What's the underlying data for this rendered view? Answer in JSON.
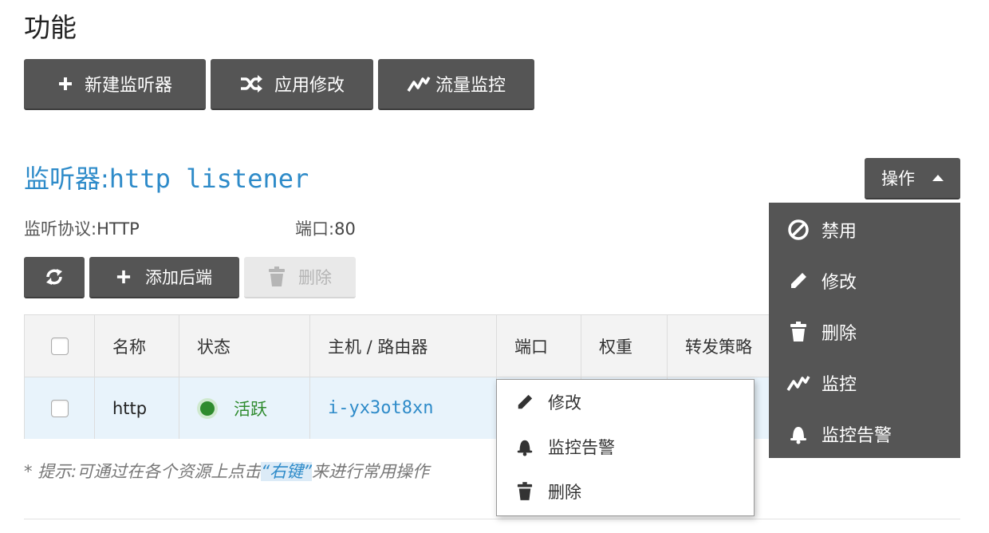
{
  "page": {
    "section_title": "功能"
  },
  "toolbar": {
    "new_listener": "新建监听器",
    "apply_changes": "应用修改",
    "traffic_monitor": "流量监控"
  },
  "listener": {
    "title_prefix": "监听器:",
    "title_name": "http listener",
    "protocol_label": "监听协议:",
    "protocol_value": "HTTP",
    "port_label": "端口:",
    "port_value": "80",
    "operations_label": "操作"
  },
  "backend_toolbar": {
    "add_backend": "添加后端",
    "delete": "删除",
    "refresh_icon": "refresh-icon"
  },
  "table": {
    "columns": [
      "名称",
      "状态",
      "主机 / 路由器",
      "端口",
      "权重",
      "转发策略"
    ],
    "rows": [
      {
        "name": "http",
        "status": "活跃",
        "host": "i-yx3ot8xn",
        "port": "",
        "weight": "",
        "policy": ""
      }
    ]
  },
  "hint": {
    "prefix": "* 提示:可通过在各个资源上点击",
    "highlight": "“右键”",
    "suffix": "来进行常用操作"
  },
  "operations_menu": {
    "items": [
      {
        "label": "禁用",
        "icon": "ban-icon"
      },
      {
        "label": "修改",
        "icon": "pencil-icon"
      },
      {
        "label": "删除",
        "icon": "trash-icon"
      },
      {
        "label": "监控",
        "icon": "chart-icon"
      },
      {
        "label": "监控告警",
        "icon": "bell-icon"
      }
    ]
  },
  "context_menu": {
    "items": [
      {
        "label": "修改",
        "icon": "pencil-icon"
      },
      {
        "label": "监控告警",
        "icon": "bell-icon"
      },
      {
        "label": "删除",
        "icon": "trash-icon"
      }
    ]
  },
  "colors": {
    "button_dark": "#555555",
    "link_blue": "#2e8bc9",
    "status_green": "#2e8b2e",
    "row_selected": "#e8f3fb"
  }
}
